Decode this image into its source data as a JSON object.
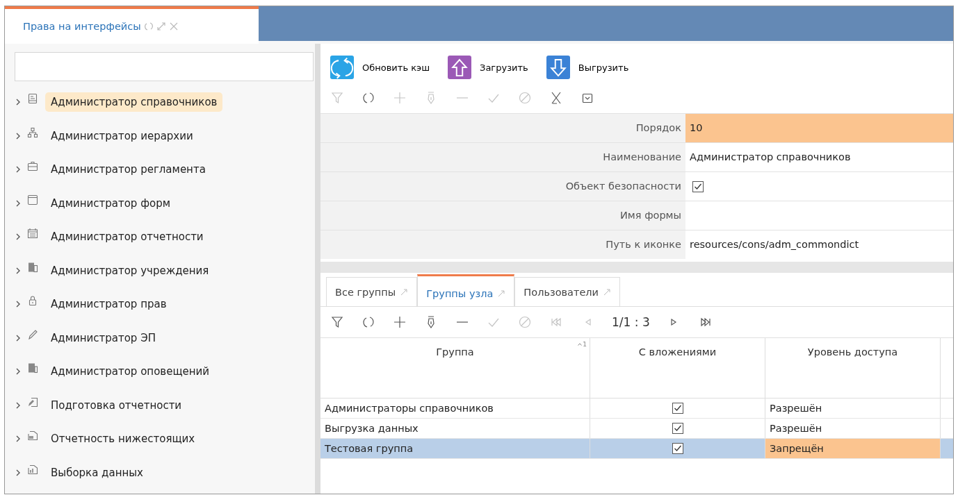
{
  "window_tab": {
    "title": "Права на интерфейсы",
    "selected": true
  },
  "tree": {
    "items": [
      {
        "label": "Администратор справочников",
        "selected": true,
        "expanded": false
      },
      {
        "label": "Администратор иерархии",
        "selected": false,
        "expanded": false
      },
      {
        "label": "Администратор регламента",
        "selected": false,
        "expanded": false
      },
      {
        "label": "Администратор форм",
        "selected": false,
        "expanded": false
      },
      {
        "label": "Администратор отчетности",
        "selected": false,
        "expanded": false
      },
      {
        "label": "Администратор учреждения",
        "selected": false,
        "expanded": false
      },
      {
        "label": "Администратор прав",
        "selected": false,
        "expanded": false
      },
      {
        "label": "Администратор ЭП",
        "selected": false,
        "expanded": false
      },
      {
        "label": "Администратор оповещений",
        "selected": false,
        "expanded": false
      },
      {
        "label": "Подготовка отчетности",
        "selected": false,
        "expanded": false
      },
      {
        "label": "Отчетность нижестоящих",
        "selected": false,
        "expanded": false
      },
      {
        "label": "Выборка данных",
        "selected": false,
        "expanded": false
      }
    ]
  },
  "actions": [
    {
      "label": "Обновить кэш",
      "kind": "refresh"
    },
    {
      "label": "Загрузить",
      "kind": "upload"
    },
    {
      "label": "Выгрузить",
      "kind": "download"
    }
  ],
  "form_toolbar": [
    {
      "kind": "filter",
      "disabled": true
    },
    {
      "kind": "refresh",
      "disabled": false
    },
    {
      "kind": "add",
      "disabled": true
    },
    {
      "kind": "edit",
      "disabled": true
    },
    {
      "kind": "remove",
      "disabled": true
    },
    {
      "kind": "apply",
      "disabled": true
    },
    {
      "kind": "cancel",
      "disabled": true
    },
    {
      "kind": "clear",
      "disabled": false
    },
    {
      "kind": "dropdown",
      "disabled": false
    }
  ],
  "form": [
    {
      "label": "Порядок",
      "kind": "text",
      "value": "10",
      "selected": true
    },
    {
      "label": "Наименование",
      "kind": "text",
      "value": "Администратор справочников",
      "selected": false
    },
    {
      "label": "Объект безопасности",
      "kind": "checkbox",
      "checked": true,
      "selected": false
    },
    {
      "label": "Имя формы",
      "kind": "text",
      "selected": false
    },
    {
      "label": "Путь к иконке",
      "kind": "text",
      "value": "resources/cons/adm_commondict",
      "selected": false
    }
  ],
  "tabs": [
    {
      "label": "Все группы",
      "selected": false
    },
    {
      "label": "Группы узла",
      "selected": true
    },
    {
      "label": "Пользователи",
      "selected": false
    }
  ],
  "grid_toolbar": [
    {
      "kind": "filter",
      "disabled": false
    },
    {
      "kind": "refresh",
      "disabled": false
    },
    {
      "kind": "add",
      "disabled": false
    },
    {
      "kind": "edit",
      "disabled": false
    },
    {
      "kind": "remove",
      "disabled": false
    },
    {
      "kind": "apply",
      "disabled": true
    },
    {
      "kind": "cancel",
      "disabled": true
    },
    {
      "kind": "first",
      "disabled": true
    },
    {
      "kind": "prev",
      "disabled": true
    },
    {
      "kind": "pager",
      "text": "1/1 : 3"
    },
    {
      "kind": "next",
      "disabled": false
    },
    {
      "kind": "last",
      "disabled": false
    }
  ],
  "table": {
    "columns": [
      {
        "label": "Группа",
        "sort_order": "1"
      },
      {
        "label": "С вложениями"
      },
      {
        "label": "Уровень доступа"
      }
    ],
    "rows": [
      {
        "group": "Администраторы справочников",
        "nested": true,
        "access": "Разрешён",
        "selected": false
      },
      {
        "group": "Выгрузка данных",
        "nested": true,
        "access": "Разрешён",
        "selected": false
      },
      {
        "group": "Тестовая группа",
        "nested": true,
        "access": "Запрещён",
        "selected": true
      }
    ]
  }
}
